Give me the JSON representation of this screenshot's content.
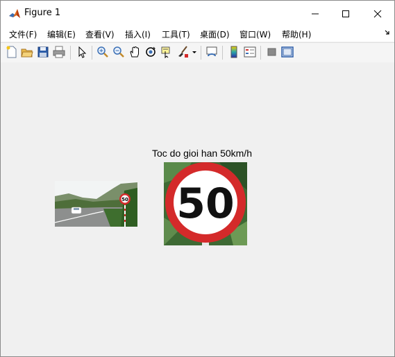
{
  "window": {
    "title": "Figure 1",
    "controls": [
      "minimize",
      "maximize",
      "close"
    ]
  },
  "menu": {
    "items": [
      {
        "label": "文件(F)"
      },
      {
        "label": "编辑(E)"
      },
      {
        "label": "查看(V)"
      },
      {
        "label": "插入(I)"
      },
      {
        "label": "工具(T)"
      },
      {
        "label": "桌面(D)"
      },
      {
        "label": "窗口(W)"
      },
      {
        "label": "帮助(H)"
      }
    ]
  },
  "toolbar": {
    "icons": [
      "new-figure-icon",
      "open-file-icon",
      "save-icon",
      "print-icon",
      "edit-plot-icon",
      "zoom-in-icon",
      "zoom-out-icon",
      "pan-icon",
      "rotate-3d-icon",
      "data-cursor-icon",
      "brush-icon",
      "link-plot-icon",
      "colorbar-icon",
      "legend-icon",
      "hide-plot-tools-icon",
      "show-plot-tools-icon"
    ]
  },
  "figure": {
    "axes_title": "Toc do gioi han 50km/h",
    "sign_text": "50",
    "small_sign_text": "50"
  },
  "colors": {
    "sign_red": "#d42a2a",
    "background": "#f0f0f0"
  }
}
